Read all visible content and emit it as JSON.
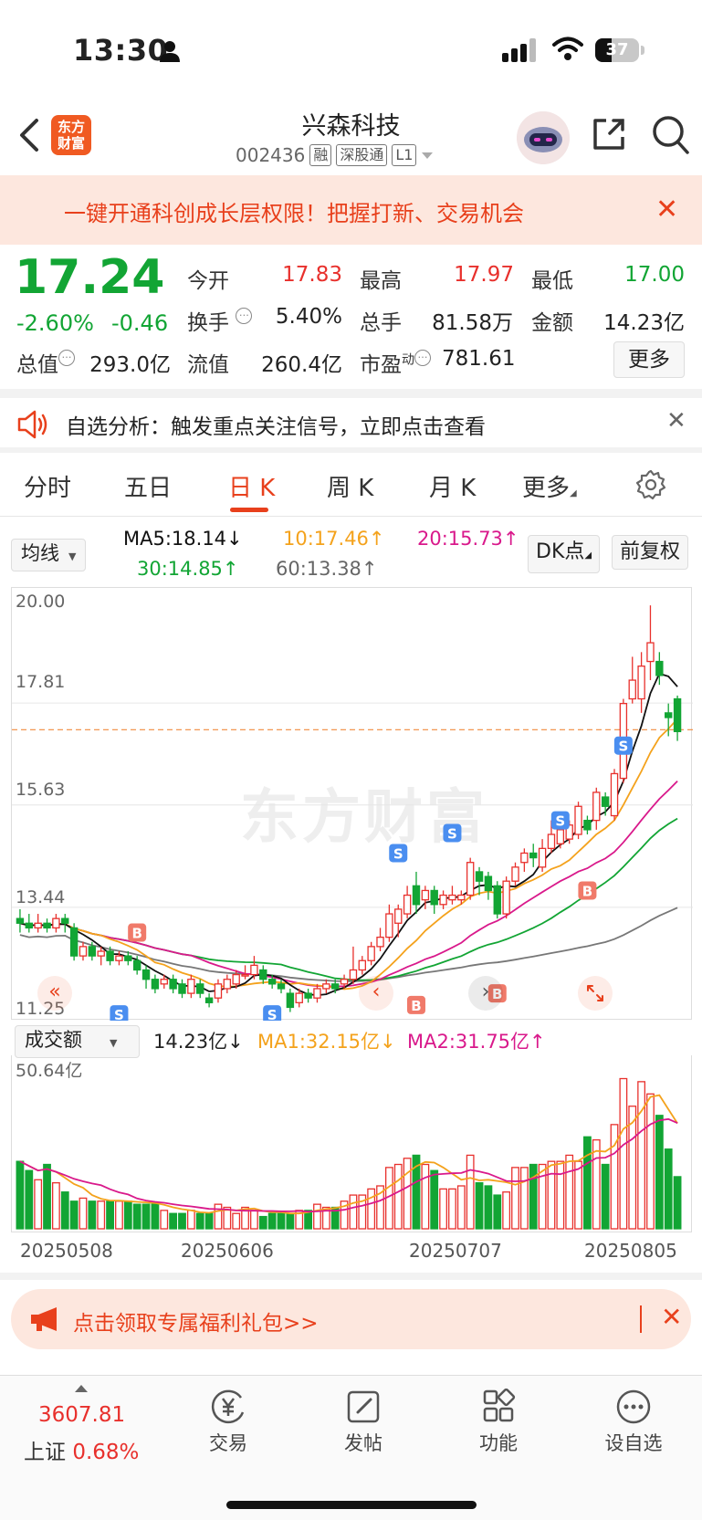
{
  "status_bar": {
    "time": "13:30",
    "battery": "37"
  },
  "header": {
    "app_logo": "东方财富",
    "title": "兴森科技",
    "code": "002436",
    "tags": [
      "融",
      "深股通",
      "L1"
    ]
  },
  "banner": {
    "text": "一键开通科创成长层权限！把握打新、交易机会",
    "close": "✕"
  },
  "quote": {
    "price": "17.24",
    "change_pct": "-2.60%",
    "change": "-0.46",
    "open_label": "今开",
    "open": "17.83",
    "high_label": "最高",
    "high": "17.97",
    "low_label": "最低",
    "low": "17.00",
    "turnover_label": "换手",
    "turnover": "5.40%",
    "volume_label": "总手",
    "volume": "81.58万",
    "amount_label": "金额",
    "amount": "14.23亿",
    "mcap_label": "总值",
    "mcap": "293.0亿",
    "float_label": "流值",
    "float": "260.4亿",
    "pe_label": "市盈",
    "pe_sup": "动",
    "pe": "781.61",
    "more": "更多"
  },
  "notice": {
    "text": "自选分析：触发重点关注信号，立即点击查看",
    "close": "✕"
  },
  "tabs": [
    "分时",
    "五日",
    "日 K",
    "周 K",
    "月 K",
    "更多"
  ],
  "ma_row": {
    "selector": "均线",
    "ma5": "MA5:18.14↓",
    "ma10": "10:17.46↑",
    "ma20": "20:15.73↑",
    "ma30": "30:14.85↑",
    "ma60": "60:13.38↑",
    "dk": "DK点",
    "fq": "前复权"
  },
  "kline_axis": [
    "20.00",
    "17.81",
    "15.63",
    "13.44",
    "11.25"
  ],
  "watermark": "东方财富",
  "signals": {
    "buy": "B",
    "sell": "S"
  },
  "volume_row": {
    "selector": "成交额",
    "value": "14.23亿↓",
    "ma1": "MA1:32.15亿↓",
    "ma2": "MA2:31.75亿↑",
    "axis_max": "50.64亿"
  },
  "dates": [
    "20250508",
    "20250606",
    "20250707",
    "20250805"
  ],
  "gift": {
    "text": "点击领取专属福利礼包>>",
    "close": "✕"
  },
  "bottom_nav": {
    "index_value": "3607.81",
    "index_name": "上证",
    "index_pct": "0.68%",
    "items": [
      "交易",
      "发帖",
      "功能",
      "设自选"
    ]
  },
  "colors": {
    "up": "#e8302c",
    "down": "#12a534",
    "accent": "#e8401c"
  },
  "chart_data": {
    "type": "candlestick",
    "ylim": [
      11.25,
      20.0
    ],
    "candles": [
      [
        13.2,
        13.1,
        13.4,
        12.9
      ],
      [
        13.1,
        13.0,
        13.3,
        12.9
      ],
      [
        13.0,
        13.1,
        13.3,
        12.9
      ],
      [
        13.1,
        13.0,
        13.2,
        12.9
      ],
      [
        13.0,
        13.2,
        13.3,
        12.9
      ],
      [
        13.2,
        13.1,
        13.3,
        12.9
      ],
      [
        13.0,
        12.4,
        13.1,
        12.3
      ],
      [
        12.4,
        12.6,
        12.7,
        12.3
      ],
      [
        12.6,
        12.4,
        12.7,
        12.3
      ],
      [
        12.4,
        12.5,
        12.6,
        12.2
      ],
      [
        12.5,
        12.3,
        12.6,
        12.2
      ],
      [
        12.3,
        12.4,
        12.5,
        12.2
      ],
      [
        12.4,
        12.3,
        12.5,
        12.2
      ],
      [
        12.3,
        12.1,
        12.4,
        12.0
      ],
      [
        12.1,
        11.9,
        12.2,
        11.7
      ],
      [
        11.9,
        11.7,
        12.0,
        11.6
      ],
      [
        11.8,
        11.9,
        12.0,
        11.7
      ],
      [
        11.9,
        11.7,
        12.0,
        11.6
      ],
      [
        11.8,
        11.6,
        11.9,
        11.5
      ],
      [
        11.6,
        11.9,
        12.0,
        11.5
      ],
      [
        11.8,
        11.6,
        11.9,
        11.5
      ],
      [
        11.5,
        11.4,
        11.6,
        11.3
      ],
      [
        11.5,
        11.8,
        11.9,
        11.4
      ],
      [
        11.7,
        11.9,
        12.0,
        11.6
      ],
      [
        11.8,
        12.0,
        12.1,
        11.7
      ],
      [
        12.0,
        12.0,
        12.2,
        11.9
      ],
      [
        12.0,
        12.2,
        12.4,
        11.9
      ],
      [
        12.1,
        11.9,
        12.2,
        11.8
      ],
      [
        11.9,
        11.8,
        12.0,
        11.7
      ],
      [
        11.8,
        11.7,
        11.9,
        11.6
      ],
      [
        11.6,
        11.3,
        11.7,
        11.2
      ],
      [
        11.4,
        11.6,
        11.7,
        11.3
      ],
      [
        11.6,
        11.5,
        11.7,
        11.4
      ],
      [
        11.5,
        11.7,
        11.8,
        11.4
      ],
      [
        11.7,
        11.8,
        11.9,
        11.6
      ],
      [
        11.8,
        11.7,
        11.9,
        11.6
      ],
      [
        11.8,
        11.9,
        12.0,
        11.7
      ],
      [
        11.9,
        12.1,
        12.6,
        11.8
      ],
      [
        12.1,
        12.3,
        12.4,
        12.0
      ],
      [
        12.3,
        12.6,
        12.7,
        12.2
      ],
      [
        12.6,
        12.8,
        13.0,
        12.5
      ],
      [
        12.8,
        13.3,
        13.5,
        12.7
      ],
      [
        13.1,
        13.4,
        13.5,
        12.8
      ],
      [
        13.3,
        13.7,
        13.9,
        13.2
      ],
      [
        13.9,
        13.5,
        14.2,
        13.3
      ],
      [
        13.6,
        13.8,
        13.9,
        13.4
      ],
      [
        13.8,
        13.5,
        13.9,
        13.3
      ],
      [
        13.5,
        13.7,
        13.8,
        13.4
      ],
      [
        13.6,
        13.7,
        13.9,
        13.5
      ],
      [
        13.6,
        13.7,
        13.8,
        13.5
      ],
      [
        13.7,
        14.4,
        14.5,
        13.6
      ],
      [
        14.2,
        14.0,
        14.3,
        13.7
      ],
      [
        14.1,
        13.8,
        14.2,
        13.6
      ],
      [
        13.9,
        13.3,
        14.0,
        13.2
      ],
      [
        13.3,
        14.0,
        14.1,
        13.2
      ],
      [
        14.0,
        14.3,
        14.4,
        13.9
      ],
      [
        14.4,
        14.6,
        14.7,
        14.2
      ],
      [
        14.6,
        14.5,
        14.8,
        14.3
      ],
      [
        14.3,
        14.7,
        14.9,
        14.2
      ],
      [
        14.7,
        15.0,
        15.3,
        14.6
      ],
      [
        14.8,
        15.1,
        15.2,
        14.7
      ],
      [
        14.9,
        15.2,
        15.3,
        14.8
      ],
      [
        15.0,
        15.6,
        15.7,
        14.9
      ],
      [
        15.3,
        15.1,
        15.4,
        15.0
      ],
      [
        15.3,
        15.9,
        16.0,
        15.1
      ],
      [
        15.8,
        15.6,
        15.9,
        15.4
      ],
      [
        15.4,
        16.3,
        16.4,
        15.3
      ],
      [
        16.2,
        17.8,
        17.9,
        16.1
      ],
      [
        17.9,
        18.3,
        18.8,
        17.8
      ],
      [
        17.9,
        18.6,
        18.9,
        17.6
      ],
      [
        18.7,
        19.1,
        19.9,
        18.3
      ],
      [
        18.7,
        18.4,
        18.9,
        18.2
      ],
      [
        17.6,
        17.5,
        17.8,
        17.1
      ],
      [
        17.9,
        17.2,
        17.97,
        17.0
      ]
    ],
    "volumes": [
      22,
      19,
      16,
      21,
      15,
      12,
      9,
      10,
      9,
      9,
      9,
      9,
      9,
      8,
      8,
      8,
      6,
      5,
      5,
      6,
      5,
      5,
      8,
      7,
      5,
      7,
      6,
      4,
      5,
      5,
      5,
      6,
      6,
      8,
      7,
      7,
      9,
      11,
      11,
      13,
      14,
      20,
      21,
      23,
      24,
      21,
      19,
      13,
      13,
      14,
      24,
      15,
      14,
      11,
      12,
      20,
      20,
      21,
      21,
      22,
      22,
      24,
      22,
      30,
      29,
      21,
      34,
      49,
      40,
      48,
      44,
      37,
      26,
      17
    ]
  }
}
